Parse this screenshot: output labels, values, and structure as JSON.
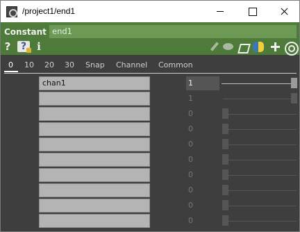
{
  "window": {
    "title": "/project1/end1"
  },
  "operator": {
    "type": "Constant",
    "name": "end1"
  },
  "header_icons": {
    "help": "?",
    "python_help": "?",
    "info": "i"
  },
  "tabs": [
    {
      "label": "0",
      "active": true
    },
    {
      "label": "10"
    },
    {
      "label": "20"
    },
    {
      "label": "30"
    },
    {
      "label": "Snap"
    },
    {
      "label": "Channel"
    },
    {
      "label": "Common"
    }
  ],
  "channels": [
    {
      "name": "chan1",
      "value": "1"
    },
    {
      "name": "",
      "value": "1"
    },
    {
      "name": "",
      "value": "0"
    },
    {
      "name": "",
      "value": "0"
    },
    {
      "name": "",
      "value": "0"
    },
    {
      "name": "",
      "value": "0"
    },
    {
      "name": "",
      "value": "0"
    },
    {
      "name": "",
      "value": "0"
    },
    {
      "name": "",
      "value": "0"
    },
    {
      "name": "",
      "value": "0"
    }
  ],
  "colors": {
    "header_green": "#4e7a3a",
    "field_green": "#6c9a54",
    "panel_bg": "#3e3e3e",
    "name_cell": "#b4b4b4"
  }
}
